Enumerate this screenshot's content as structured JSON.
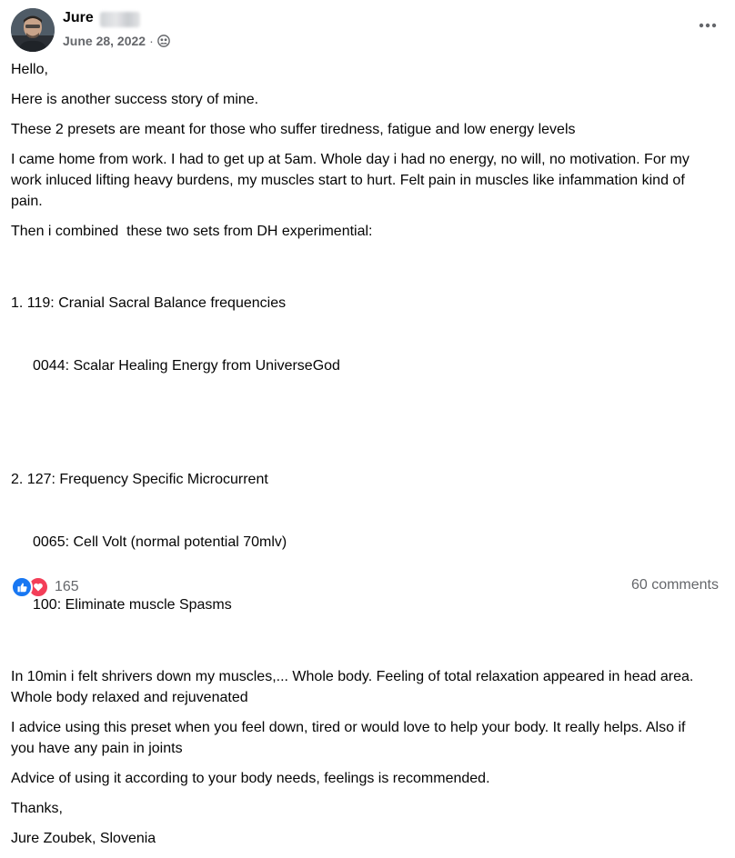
{
  "post": {
    "author_name": "Jure",
    "date": "June 28, 2022",
    "dot": "·",
    "paragraphs": [
      "Hello,",
      "Here is another success story of mine.",
      "These 2 presets are meant for those who suffer tiredness, fatigue and low energy levels",
      "I came home from work. I had to get up at 5am. Whole day i had no energy, no will, no motivation. For my work inluced lifting heavy burdens, my muscles start to hurt. Felt pain in muscles like infammation kind of pain.",
      "Then i combined  these two sets from DH experimential:"
    ],
    "list1": {
      "main": "1. 119: Cranial Sacral Balance frequencies",
      "sub": [
        "0044: Scalar Healing Energy from UniverseGod"
      ]
    },
    "list2": {
      "main": "2. 127: Frequency Specific Microcurrent",
      "sub": [
        "0065: Cell Volt (normal potential 70mlv)",
        "100: Eliminate muscle Spasms"
      ]
    },
    "paragraphs_after": [
      "In 10min i felt shrivers down my muscles,... Whole body. Feeling of total relaxation appeared in head area. Whole body relaxed and rejuvenated",
      "I advice using this preset when you feel down, tired or would love to help your body. It really helps. Also if you have any pain in joints",
      "Advice of using it according to your body needs, feelings is recommended.",
      "Thanks,",
      "Jure Zoubek, Slovenia"
    ]
  },
  "footer": {
    "reaction_count": "165",
    "comments": "60 comments"
  },
  "icons": {
    "privacy": "friends-icon",
    "more": "more-options-icon",
    "like": "like-reaction-icon",
    "love": "love-reaction-icon"
  },
  "colors": {
    "like": "#1877f2",
    "love": "#f33e58",
    "secondary_text": "#65676b"
  }
}
